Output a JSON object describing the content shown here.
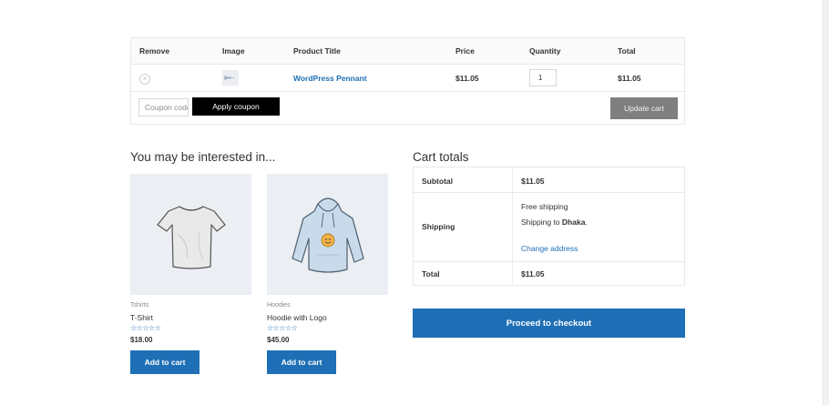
{
  "cart_table": {
    "headers": {
      "remove": "Remove",
      "image": "Image",
      "title": "Product Title",
      "price": "Price",
      "quantity": "Quantity",
      "total": "Total"
    },
    "items": [
      {
        "remove_glyph": "×",
        "title": "WordPress Pennant",
        "price": "$11.05",
        "quantity": "1",
        "total": "$11.05"
      }
    ],
    "coupon_placeholder": "Coupon code",
    "apply_label": "Apply coupon",
    "update_label": "Update cart"
  },
  "cross_sells": {
    "title": "You may be interested in...",
    "products": [
      {
        "category": "Tshirts",
        "name": "T-Shirt",
        "rating": "☆☆☆☆☆",
        "price": "$18.00",
        "add_label": "Add to cart",
        "icon": "tshirt-icon"
      },
      {
        "category": "Hoodies",
        "name": "Hoodie with Logo",
        "rating": "☆☆☆☆☆",
        "price": "$45.00",
        "add_label": "Add to cart",
        "icon": "hoodie-icon"
      }
    ]
  },
  "cart_totals": {
    "title": "Cart totals",
    "subtotal_label": "Subtotal",
    "subtotal_value": "$11.05",
    "shipping_label": "Shipping",
    "shipping_method": "Free shipping",
    "shipping_to_prefix": "Shipping to ",
    "shipping_to_place": "Dhaka",
    "shipping_to_suffix": ".",
    "change_address": "Change address",
    "total_label": "Total",
    "total_value": "$11.05",
    "checkout_label": "Proceed to checkout"
  },
  "colors": {
    "link": "#1e6fb5",
    "primary_button": "#1e6fb5",
    "apply_button": "#000000",
    "update_button": "#7f7f7f"
  }
}
